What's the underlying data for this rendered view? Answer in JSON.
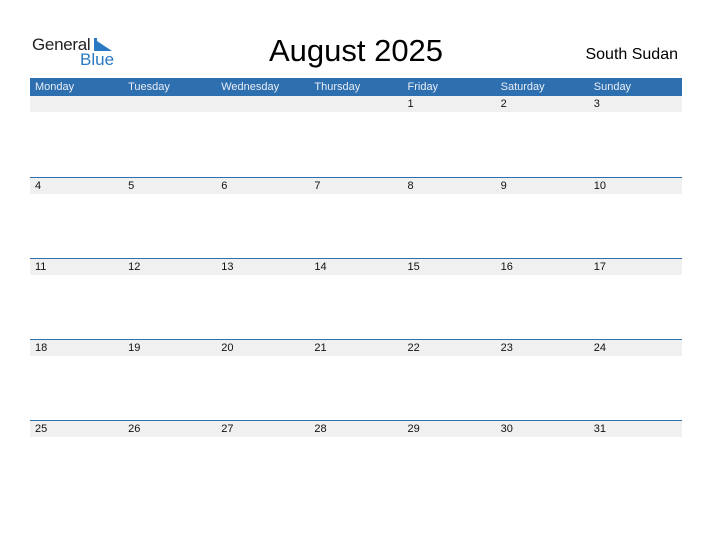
{
  "logo": {
    "general": "General",
    "blue": "Blue"
  },
  "title": "August 2025",
  "country": "South Sudan",
  "colors": {
    "header": "#2e6fb0",
    "accent": "#2b79c2",
    "strip": "#f0f0f0"
  },
  "weekdays": [
    "Monday",
    "Tuesday",
    "Wednesday",
    "Thursday",
    "Friday",
    "Saturday",
    "Sunday"
  ],
  "weeks": [
    [
      "",
      "",
      "",
      "",
      "1",
      "2",
      "3"
    ],
    [
      "4",
      "5",
      "6",
      "7",
      "8",
      "9",
      "10"
    ],
    [
      "11",
      "12",
      "13",
      "14",
      "15",
      "16",
      "17"
    ],
    [
      "18",
      "19",
      "20",
      "21",
      "22",
      "23",
      "24"
    ],
    [
      "25",
      "26",
      "27",
      "28",
      "29",
      "30",
      "31"
    ]
  ]
}
